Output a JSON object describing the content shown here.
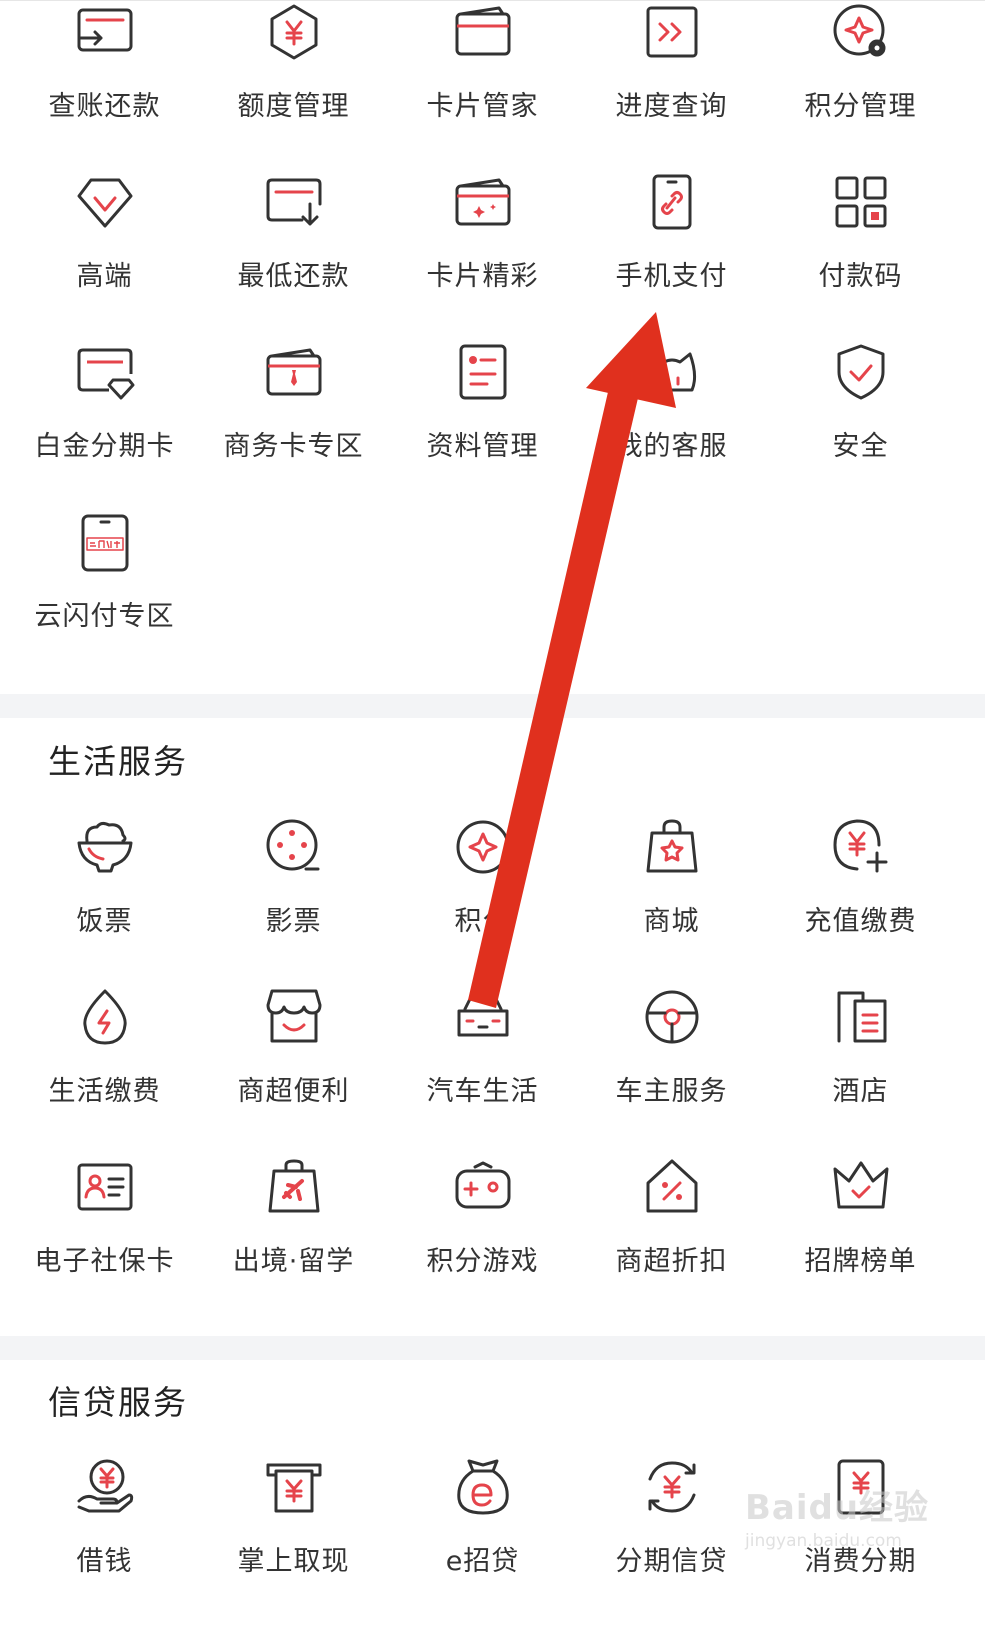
{
  "accent_color": "#e5444b",
  "card_services": {
    "items": [
      {
        "label": "查账还款",
        "icon": "bill-repay-icon"
      },
      {
        "label": "额度管理",
        "icon": "yuan-hexagon-icon"
      },
      {
        "label": "卡片管家",
        "icon": "card-wallet-icon"
      },
      {
        "label": "进度查询",
        "icon": "progress-arrows-icon"
      },
      {
        "label": "积分管理",
        "icon": "points-gear-icon"
      },
      {
        "label": "高端",
        "icon": "diamond-icon"
      },
      {
        "label": "最低还款",
        "icon": "min-repay-icon"
      },
      {
        "label": "卡片精彩",
        "icon": "card-sparkle-icon"
      },
      {
        "label": "手机支付",
        "icon": "phone-link-icon"
      },
      {
        "label": "付款码",
        "icon": "qr-code-icon"
      },
      {
        "label": "白金分期卡",
        "icon": "platinum-card-icon"
      },
      {
        "label": "商务卡专区",
        "icon": "business-card-icon"
      },
      {
        "label": "资料管理",
        "icon": "profile-doc-icon"
      },
      {
        "label": "我的客服",
        "icon": "customer-service-icon"
      },
      {
        "label": "安全",
        "icon": "shield-check-icon"
      },
      {
        "label": "云闪付专区",
        "icon": "quickpass-phone-icon"
      }
    ]
  },
  "life_services": {
    "title": "生活服务",
    "items": [
      {
        "label": "饭票",
        "icon": "rice-bowl-icon"
      },
      {
        "label": "影票",
        "icon": "film-reel-icon"
      },
      {
        "label": "积分",
        "icon": "points-star-icon"
      },
      {
        "label": "商城",
        "icon": "shopping-bag-icon"
      },
      {
        "label": "充值缴费",
        "icon": "recharge-icon"
      },
      {
        "label": "生活缴费",
        "icon": "utility-drop-icon"
      },
      {
        "label": "商超便利",
        "icon": "store-icon"
      },
      {
        "label": "汽车生活",
        "icon": "car-icon"
      },
      {
        "label": "车主服务",
        "icon": "steering-wheel-icon"
      },
      {
        "label": "酒店",
        "icon": "hotel-icon"
      },
      {
        "label": "电子社保卡",
        "icon": "id-card-icon"
      },
      {
        "label": "出境·留学",
        "icon": "plane-bag-icon"
      },
      {
        "label": "积分游戏",
        "icon": "gamepad-icon"
      },
      {
        "label": "商超折扣",
        "icon": "discount-tag-icon"
      },
      {
        "label": "招牌榜单",
        "icon": "crown-icon"
      }
    ]
  },
  "credit_services": {
    "title": "信贷服务",
    "items": [
      {
        "label": "借钱",
        "icon": "borrow-hand-icon"
      },
      {
        "label": "掌上取现",
        "icon": "atm-cash-icon"
      },
      {
        "label": "e招贷",
        "icon": "money-bag-icon"
      },
      {
        "label": "分期信贷",
        "icon": "installment-icon"
      },
      {
        "label": "消费分期",
        "icon": "consume-installment-icon"
      }
    ]
  },
  "watermark": {
    "logo": "Baidu经验",
    "url": "jingyan.baidu.com"
  }
}
